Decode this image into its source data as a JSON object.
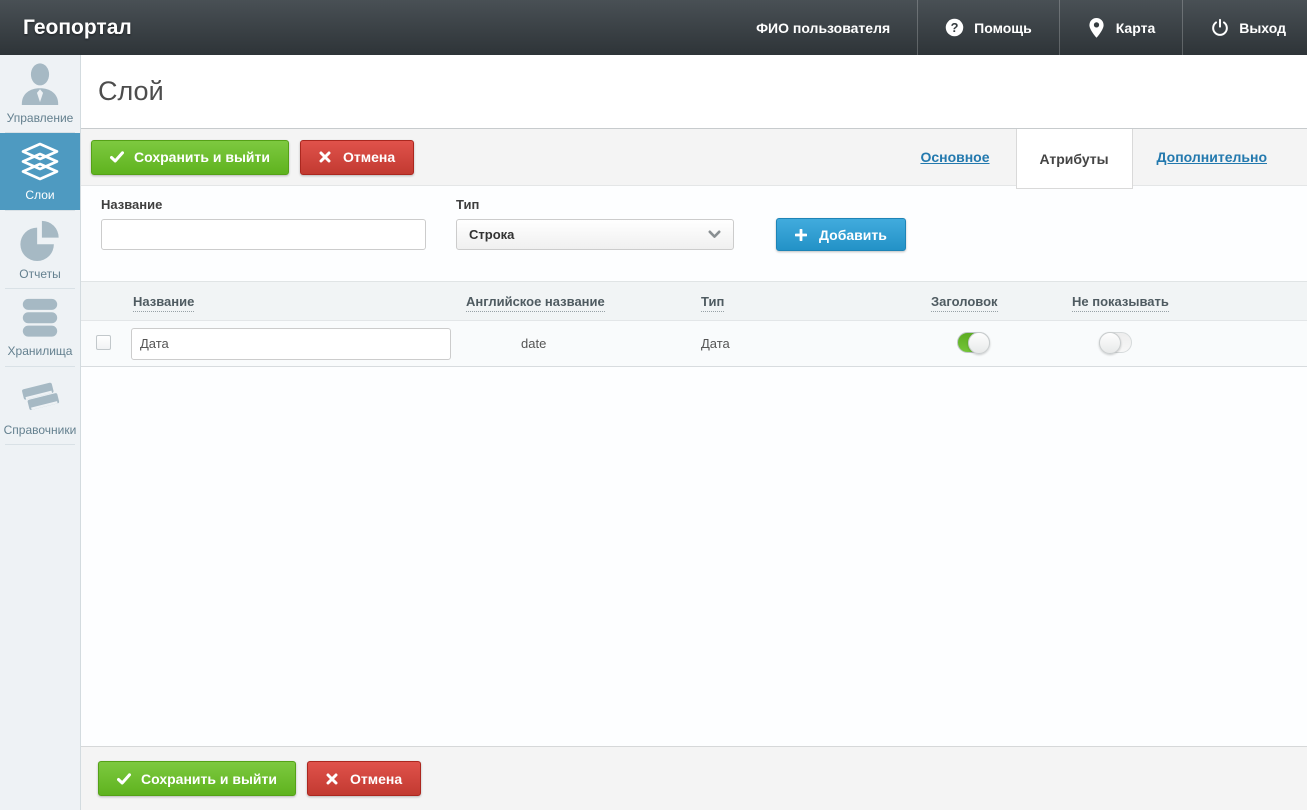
{
  "header": {
    "app_title": "Геопортал",
    "user_name": "ФИО пользователя",
    "help_label": "Помощь",
    "map_label": "Карта",
    "logout_label": "Выход"
  },
  "sidebar": {
    "items": [
      {
        "label": "Управление",
        "icon": "user-icon",
        "active": false
      },
      {
        "label": "Слои",
        "icon": "layers-icon",
        "active": true
      },
      {
        "label": "Отчеты",
        "icon": "pie-chart-icon",
        "active": false
      },
      {
        "label": "Хранилища",
        "icon": "database-icon",
        "active": false
      },
      {
        "label": "Справочники",
        "icon": "books-icon",
        "active": false
      }
    ]
  },
  "page": {
    "title": "Слой"
  },
  "actions": {
    "save_label": "Сохранить и выйти",
    "cancel_label": "Отмена"
  },
  "tabs": [
    {
      "label": "Основное",
      "active": false
    },
    {
      "label": "Атрибуты",
      "active": true
    },
    {
      "label": "Дополнительно",
      "active": false
    }
  ],
  "attribute_form": {
    "name_label": "Название",
    "name_value": "",
    "type_label": "Тип",
    "type_value": "Строка",
    "add_label": "Добавить"
  },
  "attributes_table": {
    "columns": [
      "Название",
      "Английское название",
      "Тип",
      "Заголовок",
      "Не показывать"
    ],
    "rows": [
      {
        "name_value": "Дата",
        "english_name": "date",
        "type": "Дата",
        "title_toggle": "on",
        "hide_toggle": "off",
        "selected": false
      }
    ]
  },
  "colors": {
    "header_bg": "#3b4247",
    "sidebar_bg": "#eef2f5",
    "active_nav_bg": "#4e9ac1",
    "save_green": "#6abc2c",
    "cancel_red": "#d2352c",
    "add_blue": "#2f9ed2",
    "link_blue": "#2379ae",
    "toggle_on_green": "#67b52f"
  }
}
